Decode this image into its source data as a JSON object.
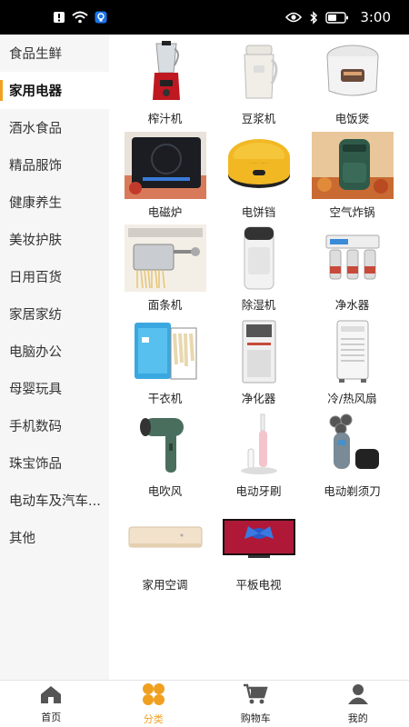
{
  "status_bar": {
    "time": "3:00"
  },
  "sidebar": {
    "active_index": 1,
    "items": [
      {
        "label": "食品生鲜"
      },
      {
        "label": "家用电器"
      },
      {
        "label": "酒水食品"
      },
      {
        "label": "精品服饰"
      },
      {
        "label": "健康养生"
      },
      {
        "label": "美妆护肤"
      },
      {
        "label": "日用百货"
      },
      {
        "label": "家居家纺"
      },
      {
        "label": "电脑办公"
      },
      {
        "label": "母婴玩具"
      },
      {
        "label": "手机数码"
      },
      {
        "label": "珠宝饰品"
      },
      {
        "label": "电动车及汽车..."
      },
      {
        "label": "其他"
      }
    ]
  },
  "products": [
    {
      "label": "榨汁机",
      "icon": "juicer-image"
    },
    {
      "label": "豆浆机",
      "icon": "soymilk-maker-image"
    },
    {
      "label": "电饭煲",
      "icon": "rice-cooker-image"
    },
    {
      "label": "电磁炉",
      "icon": "induction-cooker-image"
    },
    {
      "label": "电饼铛",
      "icon": "electric-griddle-image"
    },
    {
      "label": "空气炸锅",
      "icon": "air-fryer-image"
    },
    {
      "label": "面条机",
      "icon": "noodle-machine-image"
    },
    {
      "label": "除湿机",
      "icon": "dehumidifier-image"
    },
    {
      "label": "净水器",
      "icon": "water-purifier-image"
    },
    {
      "label": "干衣机",
      "icon": "clothes-dryer-image"
    },
    {
      "label": "净化器",
      "icon": "air-purifier-image"
    },
    {
      "label": "冷/热风扇",
      "icon": "fan-heater-image"
    },
    {
      "label": "电吹风",
      "icon": "hair-dryer-image"
    },
    {
      "label": "电动牙刷",
      "icon": "electric-toothbrush-image"
    },
    {
      "label": "电动剃须刀",
      "icon": "electric-shaver-image"
    },
    {
      "label": "家用空调",
      "icon": "air-conditioner-image"
    },
    {
      "label": "平板电视",
      "icon": "flat-tv-image"
    }
  ],
  "bottom_nav": {
    "active_index": 1,
    "items": [
      {
        "label": "首页",
        "icon": "home-icon"
      },
      {
        "label": "分类",
        "icon": "category-icon"
      },
      {
        "label": "购物车",
        "icon": "cart-icon"
      },
      {
        "label": "我的",
        "icon": "profile-icon"
      }
    ]
  },
  "colors": {
    "accent": "#f0a020",
    "sidebar_bg": "#f6f6f6"
  }
}
